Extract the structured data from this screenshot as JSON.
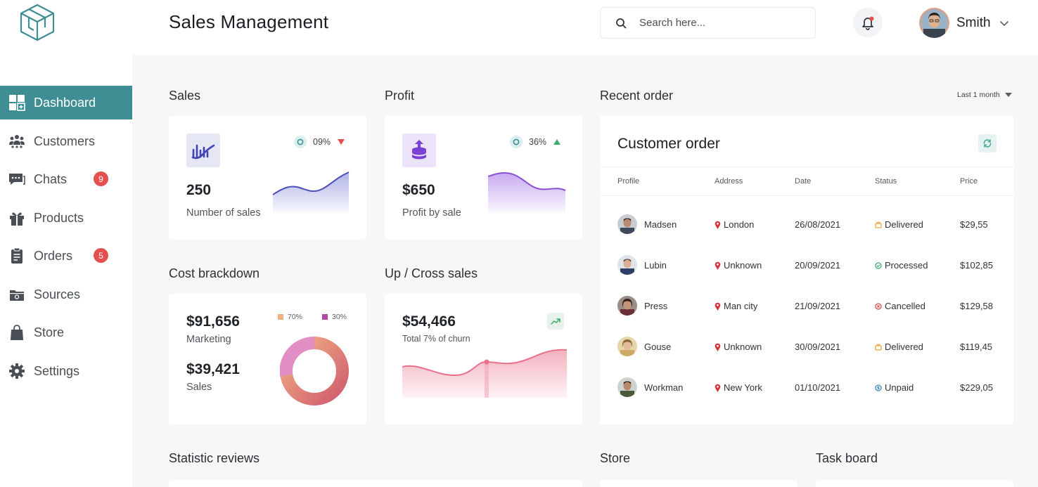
{
  "header": {
    "title": "Sales Management",
    "search_placeholder": "Search here...",
    "user_name": "Smith"
  },
  "sidebar": {
    "items": [
      {
        "label": "Dashboard",
        "icon": "dashboard-icon",
        "active": true
      },
      {
        "label": "Customers",
        "icon": "customers-icon"
      },
      {
        "label": "Chats",
        "icon": "chats-icon",
        "badge": "9"
      },
      {
        "label": "Products",
        "icon": "products-icon"
      },
      {
        "label": "Orders",
        "icon": "orders-icon",
        "badge": "5"
      },
      {
        "label": "Sources",
        "icon": "sources-icon"
      },
      {
        "label": "Store",
        "icon": "store-icon"
      },
      {
        "label": "Settings",
        "icon": "settings-icon"
      }
    ]
  },
  "sales": {
    "section_title": "Sales",
    "value": "250",
    "label": "Number of sales",
    "change": "09%",
    "direction": "down"
  },
  "profit": {
    "section_title": "Profit",
    "value": "$650",
    "label": "Profit by sale",
    "change": "36%",
    "direction": "up"
  },
  "cost": {
    "section_title": "Cost brackdown",
    "marketing_value": "$91,656",
    "marketing_label": "Marketing",
    "sales_value": "$39,421",
    "sales_label": "Sales",
    "legend": [
      {
        "label": "70%",
        "color": "#f2b184"
      },
      {
        "label": "30%",
        "color": "#b04aa4"
      }
    ],
    "donut": {
      "marketing_pct": 70,
      "sales_pct": 30
    }
  },
  "cross": {
    "section_title": "Up / Cross sales",
    "value": "$54,466",
    "label": "Total 7% of churn"
  },
  "recent": {
    "section_title": "Recent order",
    "filter": "Last 1 month",
    "card_title": "Customer order",
    "columns": [
      "Profile",
      "Address",
      "Date",
      "Status",
      "Price"
    ],
    "rows": [
      {
        "name": "Madsen",
        "address": "London",
        "date": "26/08/2021",
        "status": "Delivered",
        "status_color": "#f0a33a",
        "price": "$29,55"
      },
      {
        "name": "Lubin",
        "address": "Unknown",
        "date": "20/09/2021",
        "status": "Processed",
        "status_color": "#3fa96b",
        "price": "$102,85"
      },
      {
        "name": "Press",
        "address": "Man city",
        "date": "21/09/2021",
        "status": "Cancelled",
        "status_color": "#e0524e",
        "price": "$129,58"
      },
      {
        "name": "Gouse",
        "address": "Unknown",
        "date": "30/09/2021",
        "status": "Delivered",
        "status_color": "#f0a33a",
        "price": "$119,45"
      },
      {
        "name": "Workman",
        "address": "New York",
        "date": "01/10/2021",
        "status": "Unpaid",
        "status_color": "#3a8fb7",
        "price": "$229,05"
      }
    ]
  },
  "bottom": {
    "statistic": "Statistic reviews",
    "store": "Store",
    "task": "Task board"
  },
  "colors": {
    "accent": "#3e8e93",
    "badge": "#e2514f",
    "sales_line": "#4b4fb8",
    "profit_line": "#8a4fd6",
    "cross_line": "#e9708a"
  }
}
